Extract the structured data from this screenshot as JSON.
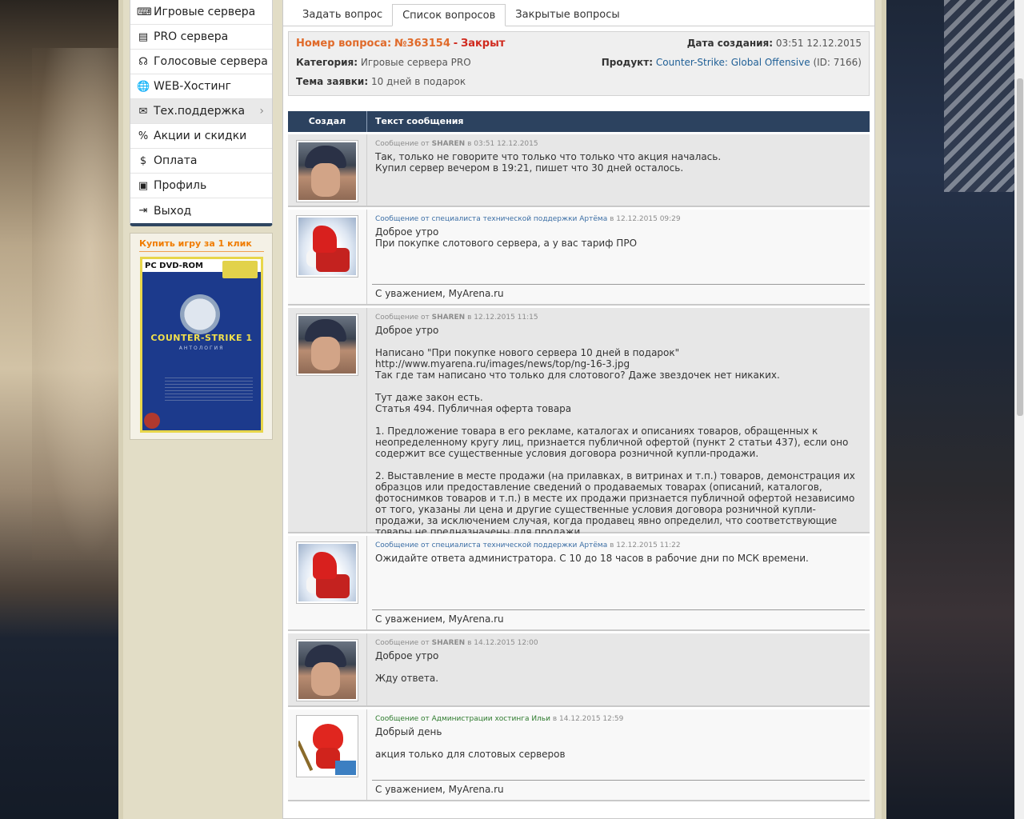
{
  "sidebar": {
    "items": [
      {
        "label": "Игровые сервера",
        "icon": "gamepad-icon"
      },
      {
        "label": "PRO сервера",
        "icon": "server-icon"
      },
      {
        "label": "Голосовые сервера",
        "icon": "headset-icon"
      },
      {
        "label": "WEB-Хостинг",
        "icon": "globe-icon"
      },
      {
        "label": "Тех.поддержка",
        "icon": "chat-icon"
      },
      {
        "label": "Акции и скидки",
        "icon": "percent-icon"
      },
      {
        "label": "Оплата",
        "icon": "dollar-icon"
      },
      {
        "label": "Профиль",
        "icon": "profile-icon"
      },
      {
        "label": "Выход",
        "icon": "logout-icon"
      }
    ],
    "active_item": "Тех.поддержка",
    "promo": {
      "title": "Купить игру за 1 клик",
      "box_pc": "PC DVD-ROM",
      "box_title": "COUNTER-STRIKE 1",
      "box_subtitle": "АНТОЛОГИЯ"
    }
  },
  "tabs": [
    "Задать вопрос",
    "Список вопросов",
    "Закрытые вопросы"
  ],
  "active_tab": "Список вопросов",
  "ticket": {
    "number_label": "Номер вопроса:",
    "number": "№363154",
    "separator": "-",
    "status": "Закрыт",
    "created_label": "Дата создания:",
    "created": "03:51 12.12.2015",
    "category_label": "Категория:",
    "category": "Игровые сервера PRO",
    "product_label": "Продукт:",
    "product": "Counter-Strike: Global Offensive",
    "product_id": "(ID: 7166)",
    "subject_label": "Тема заявки:",
    "subject": "10 дней в подарок"
  },
  "table": {
    "col_author": "Создал",
    "col_text": "Текст сообщения"
  },
  "messages": [
    {
      "kind": "user",
      "meta_prefix": "Сообщение от",
      "author": "SHAREN",
      "meta_in": "в",
      "time": "03:51 12.12.2015",
      "text": "Так, только не говорите что только что только что акция началась.\nКупил сервер вечером в 19:21, пишет что 30 дней осталось."
    },
    {
      "kind": "staff",
      "meta_prefix": "Сообщение от специалиста технической поддержки Артёма",
      "meta_in": "в",
      "time": "12.12.2015 09:29",
      "text": "Доброе утро\nПри покупке слотового сервера, а у вас тариф ПРО",
      "signature": "С уважением, MyArena.ru"
    },
    {
      "kind": "user",
      "meta_prefix": "Сообщение от",
      "author": "SHAREN",
      "meta_in": "в",
      "time": "12.12.2015 11:15",
      "text": "Доброе утро\n\nНаписано \"При покупке нового сервера 10 дней в подарок\" http://www.myarena.ru/images/news/top/ng-16-3.jpg\nТак где там написано что только для слотового? Даже звездочек нет никаких.\n\nТут даже закон есть.\nСтатья 494. Публичная оферта товара\n\n1. Предложение товара в его рекламе, каталогах и описаниях товаров, обращенных к неопределенному кругу лиц, признается публичной офертой (пункт 2 статьи 437), если оно содержит все существенные условия договора розничной купли-продажи.\n\n2. Выставление в месте продажи (на прилавках, в витринах и т.п.) товаров, демонстрация их образцов или предоставление сведений о продаваемых товарах (описаний, каталогов, фотоснимков товаров и т.п.) в месте их продажи признается публичной офертой независимо от того, указаны ли цена и другие существенные условия договора розничной купли-продажи, за исключением случая, когда продавец явно определил, что соответствующие товары не предназначены для продажи."
    },
    {
      "kind": "staff",
      "meta_prefix": "Сообщение от специалиста технической поддержки Артёма",
      "meta_in": "в",
      "time": "12.12.2015 11:22",
      "text": "Ожидайте ответа администратора. С 10 до 18 часов в рабочие дни по МСК времени.",
      "signature": "С уважением, MyArena.ru"
    },
    {
      "kind": "user",
      "meta_prefix": "Сообщение от",
      "author": "SHAREN",
      "meta_in": "в",
      "time": "14.12.2015 12:00",
      "text": "Доброе утро\n\nЖду ответа."
    },
    {
      "kind": "admin",
      "meta_prefix": "Сообщение от Администрации хостинга Ильи",
      "meta_in": "в",
      "time": "14.12.2015 12:59",
      "text": "Добрый день\n\nакция только для слотовых серверов",
      "signature": "С уважением, MyArena.ru"
    }
  ],
  "colors": {
    "accent_orange": "#e06a2a",
    "closed_red": "#d02a1e",
    "header_navy": "#2c425f",
    "staff_blue": "#3b6ea5",
    "admin_green": "#2d7a2d"
  }
}
